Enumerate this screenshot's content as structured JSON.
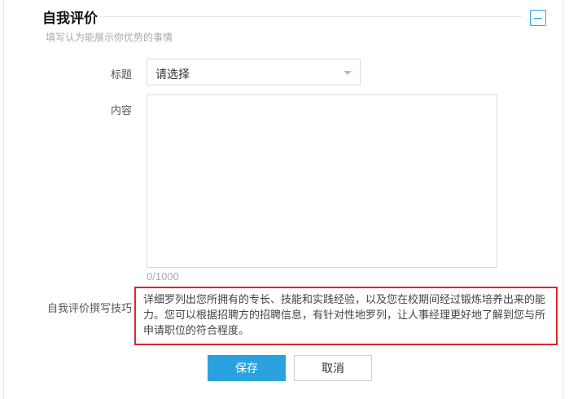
{
  "section": {
    "title": "自我评价",
    "subtitle": "填写认为能展示你优势的事情"
  },
  "form": {
    "title_label": "标题",
    "title_select_value": "请选择",
    "content_label": "内容",
    "content_value": "",
    "char_counter": "0/1000",
    "tips_label": "自我评价撰写技巧",
    "tips_text": "详细罗列出您所拥有的专长、技能和实践经验，以及您在校期间经过锻炼培养出来的能力。您可以根据招聘方的招聘信息，有针对性地罗列，让人事经理更好地了解到您与所申请职位的符合程度。"
  },
  "actions": {
    "save_label": "保存",
    "cancel_label": "取消"
  },
  "icons": {
    "collapse": "collapse-minus-icon",
    "dropdown": "chevron-down-icon"
  },
  "colors": {
    "accent": "#2aa2e0",
    "highlight_border": "#e0262b"
  }
}
